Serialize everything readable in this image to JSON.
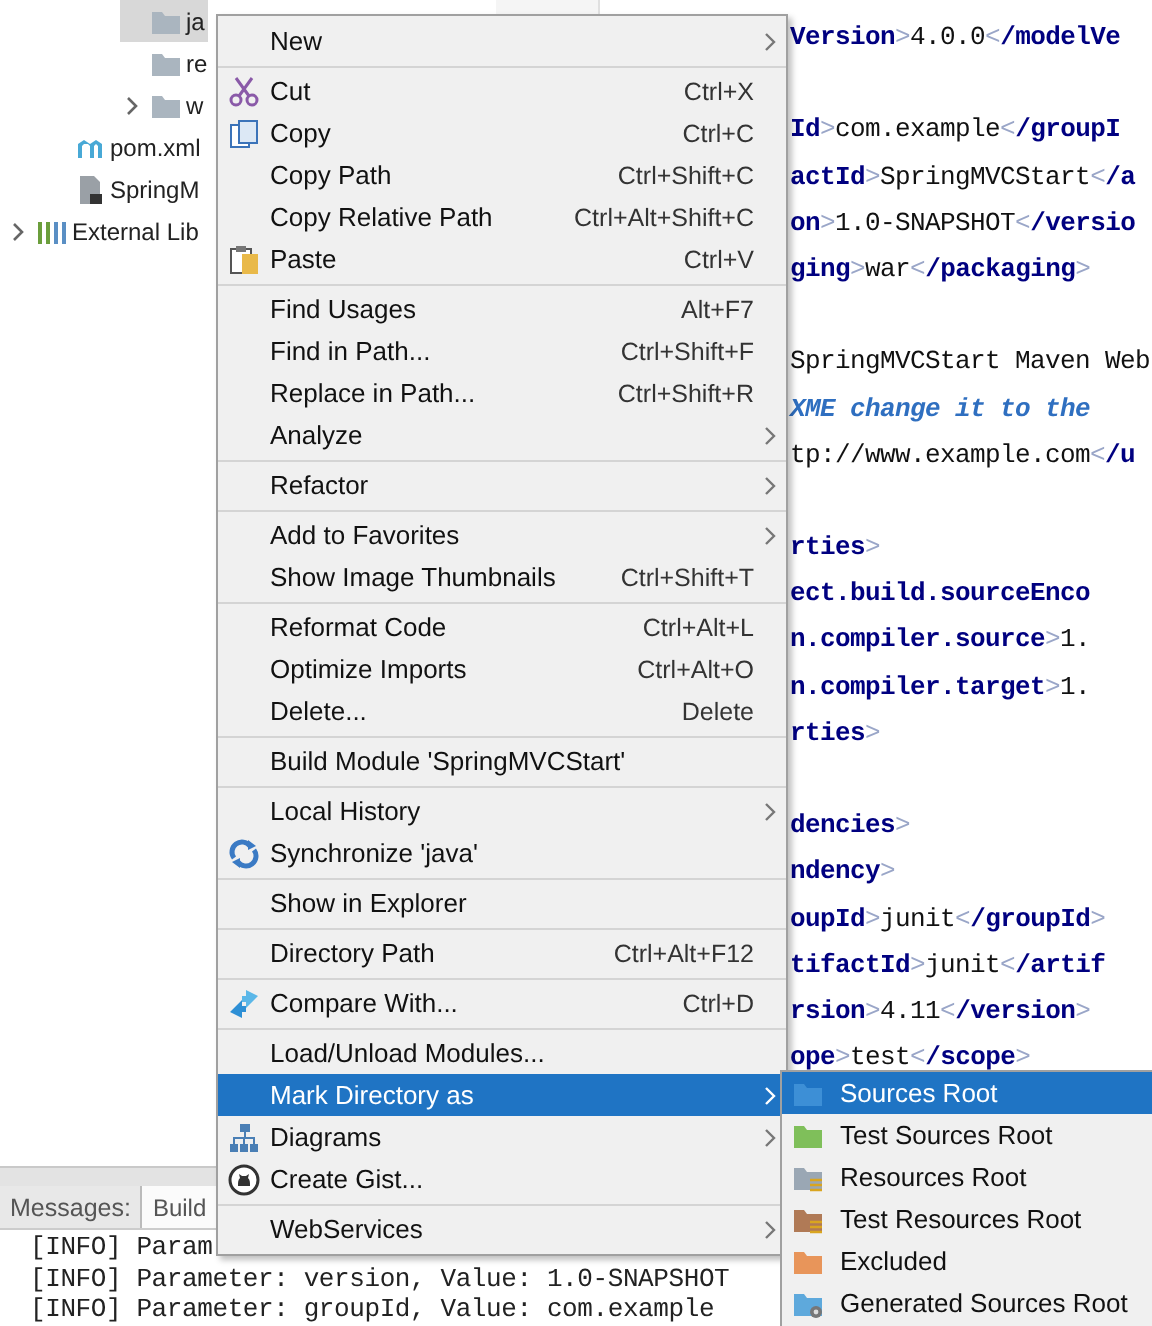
{
  "project_tree": [
    {
      "children": [
        {
          "children": [
            {
              "children": [
                {
                  "label": "ja",
                  "kind": "folder",
                  "expandable": false,
                  "selected": true
                },
                {
                  "label": "re",
                  "kind": "folder",
                  "expandable": false,
                  "selected": false
                },
                {
                  "label": "w",
                  "kind": "folder",
                  "expandable": true,
                  "selected": false
                }
              ]
            }
          ]
        },
        {
          "label": "pom.xml",
          "kind": "maven",
          "expandable": false,
          "selected": false
        },
        {
          "label": "SpringM",
          "kind": "module",
          "expandable": false,
          "selected": false
        }
      ]
    },
    {
      "label": "External Lib",
      "kind": "library",
      "expandable": true,
      "selected": false
    }
  ],
  "editor": {
    "lines": [
      {
        "blank_before": false,
        "tokens": [
          {
            "kind": "tag",
            "text": "Version"
          },
          {
            "kind": "punct",
            "text": ">"
          },
          {
            "kind": "text",
            "text": "4.0.0"
          },
          {
            "kind": "punct",
            "text": "<"
          },
          {
            "kind": "tag",
            "text": "/modelVe"
          }
        ]
      },
      {
        "blank_before": true,
        "tokens": [
          {
            "kind": "tag",
            "text": "Id"
          },
          {
            "kind": "punct",
            "text": ">"
          },
          {
            "kind": "text",
            "text": "com.example"
          },
          {
            "kind": "punct",
            "text": "<"
          },
          {
            "kind": "tag",
            "text": "/groupI"
          }
        ]
      },
      {
        "blank_before": false,
        "tokens": [
          {
            "kind": "tag",
            "text": "actId"
          },
          {
            "kind": "punct",
            "text": ">"
          },
          {
            "kind": "text",
            "text": "SpringMVCStart"
          },
          {
            "kind": "punct",
            "text": "<"
          },
          {
            "kind": "tag",
            "text": "/a"
          }
        ]
      },
      {
        "blank_before": false,
        "tokens": [
          {
            "kind": "tag",
            "text": "on"
          },
          {
            "kind": "punct",
            "text": ">"
          },
          {
            "kind": "text",
            "text": "1.0-SNAPSHOT"
          },
          {
            "kind": "punct",
            "text": "<"
          },
          {
            "kind": "tag",
            "text": "/versio"
          }
        ]
      },
      {
        "blank_before": false,
        "tokens": [
          {
            "kind": "tag",
            "text": "ging"
          },
          {
            "kind": "punct",
            "text": ">"
          },
          {
            "kind": "text",
            "text": "war"
          },
          {
            "kind": "punct",
            "text": "<"
          },
          {
            "kind": "tag",
            "text": "/packaging"
          },
          {
            "kind": "punct",
            "text": ">"
          }
        ]
      },
      {
        "blank_before": true,
        "tokens": [
          {
            "kind": "text",
            "text": "SpringMVCStart Maven Web"
          }
        ]
      },
      {
        "blank_before": false,
        "tokens": [
          {
            "kind": "comment",
            "text": "XME change it to the"
          }
        ]
      },
      {
        "blank_before": false,
        "tokens": [
          {
            "kind": "text",
            "text": "tp://www.example.com"
          },
          {
            "kind": "punct",
            "text": "<"
          },
          {
            "kind": "tag",
            "text": "/u"
          }
        ]
      },
      {
        "blank_before": true,
        "tokens": [
          {
            "kind": "tag",
            "text": "rties"
          },
          {
            "kind": "punct",
            "text": ">"
          }
        ]
      },
      {
        "blank_before": false,
        "tokens": [
          {
            "kind": "tag",
            "text": "ect.build.sourceEnco"
          }
        ]
      },
      {
        "blank_before": false,
        "tokens": [
          {
            "kind": "tag",
            "text": "n.compiler.source"
          },
          {
            "kind": "punct",
            "text": ">"
          },
          {
            "kind": "text",
            "text": "1."
          }
        ]
      },
      {
        "blank_before": false,
        "tokens": [
          {
            "kind": "tag",
            "text": "n.compiler.target"
          },
          {
            "kind": "punct",
            "text": ">"
          },
          {
            "kind": "text",
            "text": "1."
          }
        ]
      },
      {
        "blank_before": false,
        "tokens": [
          {
            "kind": "tag",
            "text": "rties"
          },
          {
            "kind": "punct",
            "text": ">"
          }
        ]
      },
      {
        "blank_before": true,
        "tokens": [
          {
            "kind": "tag",
            "text": "dencies"
          },
          {
            "kind": "punct",
            "text": ">"
          }
        ]
      },
      {
        "blank_before": false,
        "tokens": [
          {
            "kind": "tag",
            "text": "ndency"
          },
          {
            "kind": "punct",
            "text": ">"
          }
        ]
      },
      {
        "blank_before": false,
        "tokens": [
          {
            "kind": "tag",
            "text": "oupId"
          },
          {
            "kind": "punct",
            "text": ">"
          },
          {
            "kind": "text",
            "text": "junit"
          },
          {
            "kind": "punct",
            "text": "<"
          },
          {
            "kind": "tag",
            "text": "/groupId"
          },
          {
            "kind": "punct",
            "text": ">"
          }
        ]
      },
      {
        "blank_before": false,
        "tokens": [
          {
            "kind": "tag",
            "text": "tifactId"
          },
          {
            "kind": "punct",
            "text": ">"
          },
          {
            "kind": "text",
            "text": "junit"
          },
          {
            "kind": "punct",
            "text": "<"
          },
          {
            "kind": "tag",
            "text": "/artif"
          }
        ]
      },
      {
        "blank_before": false,
        "tokens": [
          {
            "kind": "tag",
            "text": "rsion"
          },
          {
            "kind": "punct",
            "text": ">"
          },
          {
            "kind": "text",
            "text": "4.11"
          },
          {
            "kind": "punct",
            "text": "<"
          },
          {
            "kind": "tag",
            "text": "/version"
          },
          {
            "kind": "punct",
            "text": ">"
          }
        ]
      },
      {
        "blank_before": false,
        "tokens": [
          {
            "kind": "tag",
            "text": "ope"
          },
          {
            "kind": "punct",
            "text": ">"
          },
          {
            "kind": "text",
            "text": "test"
          },
          {
            "kind": "punct",
            "text": "<"
          },
          {
            "kind": "tag",
            "text": "/scope"
          },
          {
            "kind": "punct",
            "text": ">"
          }
        ]
      }
    ]
  },
  "bottom_panel": {
    "title": "Messages:",
    "tabs": [
      {
        "label": "Build",
        "selected": true
      }
    ],
    "log": [
      "[INFO] Param",
      "[INFO] Parameter: version, Value: 1.0-SNAPSHOT",
      "[INFO] Parameter: groupId, Value: com.example"
    ]
  },
  "context_menu": {
    "groups": [
      [
        {
          "label": "New",
          "kind": "plain",
          "submenu": true,
          "selected": false
        }
      ],
      [
        {
          "label": "Cut",
          "shortcut": "Ctrl+X",
          "kind": "scissors",
          "submenu": false,
          "selected": false
        },
        {
          "label": "Copy",
          "shortcut": "Ctrl+C",
          "kind": "copy",
          "submenu": false,
          "selected": false
        },
        {
          "label": "Copy Path",
          "shortcut": "Ctrl+Shift+C",
          "kind": "plain",
          "submenu": false,
          "selected": false
        },
        {
          "label": "Copy Relative Path",
          "shortcut": "Ctrl+Alt+Shift+C",
          "kind": "plain",
          "submenu": false,
          "selected": false
        },
        {
          "label": "Paste",
          "shortcut": "Ctrl+V",
          "kind": "paste",
          "submenu": false,
          "selected": false
        }
      ],
      [
        {
          "label": "Find Usages",
          "shortcut": "Alt+F7",
          "kind": "plain",
          "submenu": false,
          "selected": false
        },
        {
          "label": "Find in Path...",
          "shortcut": "Ctrl+Shift+F",
          "kind": "plain",
          "submenu": false,
          "selected": false
        },
        {
          "label": "Replace in Path...",
          "shortcut": "Ctrl+Shift+R",
          "kind": "plain",
          "submenu": false,
          "selected": false
        },
        {
          "label": "Analyze",
          "kind": "plain",
          "submenu": true,
          "selected": false
        }
      ],
      [
        {
          "label": "Refactor",
          "kind": "plain",
          "submenu": true,
          "selected": false
        }
      ],
      [
        {
          "label": "Add to Favorites",
          "kind": "plain",
          "submenu": true,
          "selected": false
        },
        {
          "label": "Show Image Thumbnails",
          "shortcut": "Ctrl+Shift+T",
          "kind": "plain",
          "submenu": false,
          "selected": false
        }
      ],
      [
        {
          "label": "Reformat Code",
          "shortcut": "Ctrl+Alt+L",
          "kind": "plain",
          "submenu": false,
          "selected": false
        },
        {
          "label": "Optimize Imports",
          "shortcut": "Ctrl+Alt+O",
          "kind": "plain",
          "submenu": false,
          "selected": false
        },
        {
          "label": "Delete...",
          "shortcut": "Delete",
          "kind": "plain",
          "submenu": false,
          "selected": false
        }
      ],
      [
        {
          "label": "Build Module 'SpringMVCStart'",
          "kind": "plain",
          "submenu": false,
          "selected": false
        }
      ],
      [
        {
          "label": "Local History",
          "kind": "plain",
          "submenu": true,
          "selected": false
        },
        {
          "label": "Synchronize 'java'",
          "kind": "sync",
          "submenu": false,
          "selected": false
        }
      ],
      [
        {
          "label": "Show in Explorer",
          "kind": "plain",
          "submenu": false,
          "selected": false
        }
      ],
      [
        {
          "label": "Directory Path",
          "shortcut": "Ctrl+Alt+F12",
          "kind": "plain",
          "submenu": false,
          "selected": false
        }
      ],
      [
        {
          "label": "Compare With...",
          "shortcut": "Ctrl+D",
          "kind": "compare",
          "submenu": false,
          "selected": false
        }
      ],
      [
        {
          "label": "Load/Unload Modules...",
          "kind": "plain",
          "submenu": false,
          "selected": false
        },
        {
          "label": "Mark Directory as",
          "kind": "plain",
          "submenu": true,
          "selected": true
        },
        {
          "label": "Diagrams",
          "kind": "diagram",
          "submenu": true,
          "selected": false
        },
        {
          "label": "Create Gist...",
          "kind": "gist",
          "submenu": false,
          "selected": false
        }
      ],
      [
        {
          "label": "WebServices",
          "kind": "plain",
          "submenu": true,
          "selected": false
        }
      ]
    ]
  },
  "submenu": {
    "items": [
      {
        "label": "Sources Root",
        "kind": "folder",
        "color": "#3d8fd6",
        "selected": true
      },
      {
        "label": "Test Sources Root",
        "kind": "folder",
        "color": "#7fbf5a",
        "selected": false
      },
      {
        "label": "Resources Root",
        "kind": "folder-lines",
        "color": "#9aa7b4",
        "selected": false
      },
      {
        "label": "Test Resources Root",
        "kind": "folder-lines",
        "color": "#b07a56",
        "selected": false
      },
      {
        "label": "Excluded",
        "kind": "folder",
        "color": "#e8955a",
        "selected": false
      },
      {
        "label": "Generated Sources Root",
        "kind": "folder-gear",
        "color": "#5ea9dc",
        "selected": false
      }
    ]
  }
}
